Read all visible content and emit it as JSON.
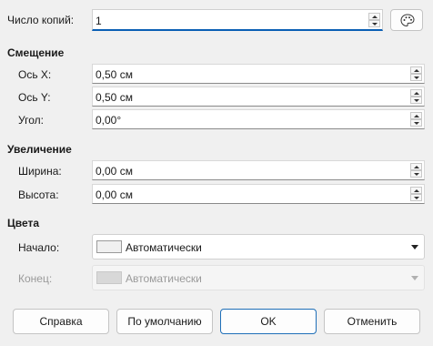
{
  "copies": {
    "label": "Число копий:",
    "value": "1",
    "color_button_icon": "palette-icon"
  },
  "offset": {
    "heading": "Смещение",
    "x_label": "Ось X:",
    "x_value": "0,50 см",
    "y_label": "Ось Y:",
    "y_value": "0,50 см",
    "angle_label": "Угол:",
    "angle_value": "0,00°"
  },
  "enlargement": {
    "heading": "Увеличение",
    "width_label": "Ширина:",
    "width_value": "0,00 см",
    "height_label": "Высота:",
    "height_value": "0,00 см"
  },
  "colors": {
    "heading": "Цвета",
    "start_label": "Начало:",
    "start_value": "Автоматически",
    "end_label": "Конец:",
    "end_value": "Автоматически"
  },
  "buttons": {
    "help": "Справка",
    "reset": "По умолчанию",
    "ok": "OK",
    "cancel": "Отменить"
  },
  "accent": "#0a5fb4"
}
